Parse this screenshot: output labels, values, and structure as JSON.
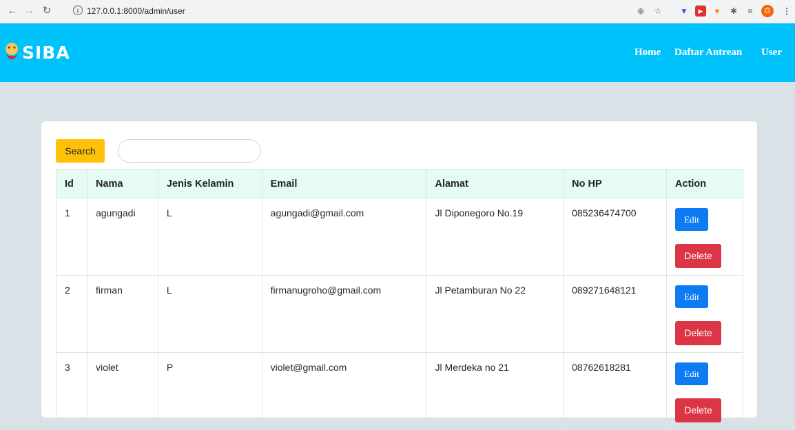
{
  "browser": {
    "url": "127.0.0.1:8000/admin/user",
    "avatar_initial": "G"
  },
  "header": {
    "brand": "SIBA",
    "nav": [
      "Home",
      "Daftar Antrean",
      "User"
    ]
  },
  "search": {
    "button_label": "Search",
    "value": ""
  },
  "table": {
    "columns": [
      "Id",
      "Nama",
      "Jenis Kelamin",
      "Email",
      "Alamat",
      "No HP",
      "Action"
    ],
    "edit_label": "Edit",
    "delete_label": "Delete",
    "rows": [
      [
        "1",
        "agungadi",
        "L",
        "agungadi@gmail.com",
        "Jl Diponegoro No.19",
        "085236474700"
      ],
      [
        "2",
        "firman",
        "L",
        "firmanugroho@gmail.com",
        "Jl Petamburan No 22",
        "089271648121"
      ],
      [
        "3",
        "violet",
        "P",
        "violet@gmail.com",
        "Jl Merdeka no 21",
        "08762618281"
      ]
    ]
  },
  "colors": {
    "header": "#00c2fa",
    "page_bg": "#d9e2e6",
    "search_button": "#ffc107",
    "edit_button": "#0d7cf2",
    "delete_button": "#dc3545",
    "table_header": "#e6fbf3"
  }
}
